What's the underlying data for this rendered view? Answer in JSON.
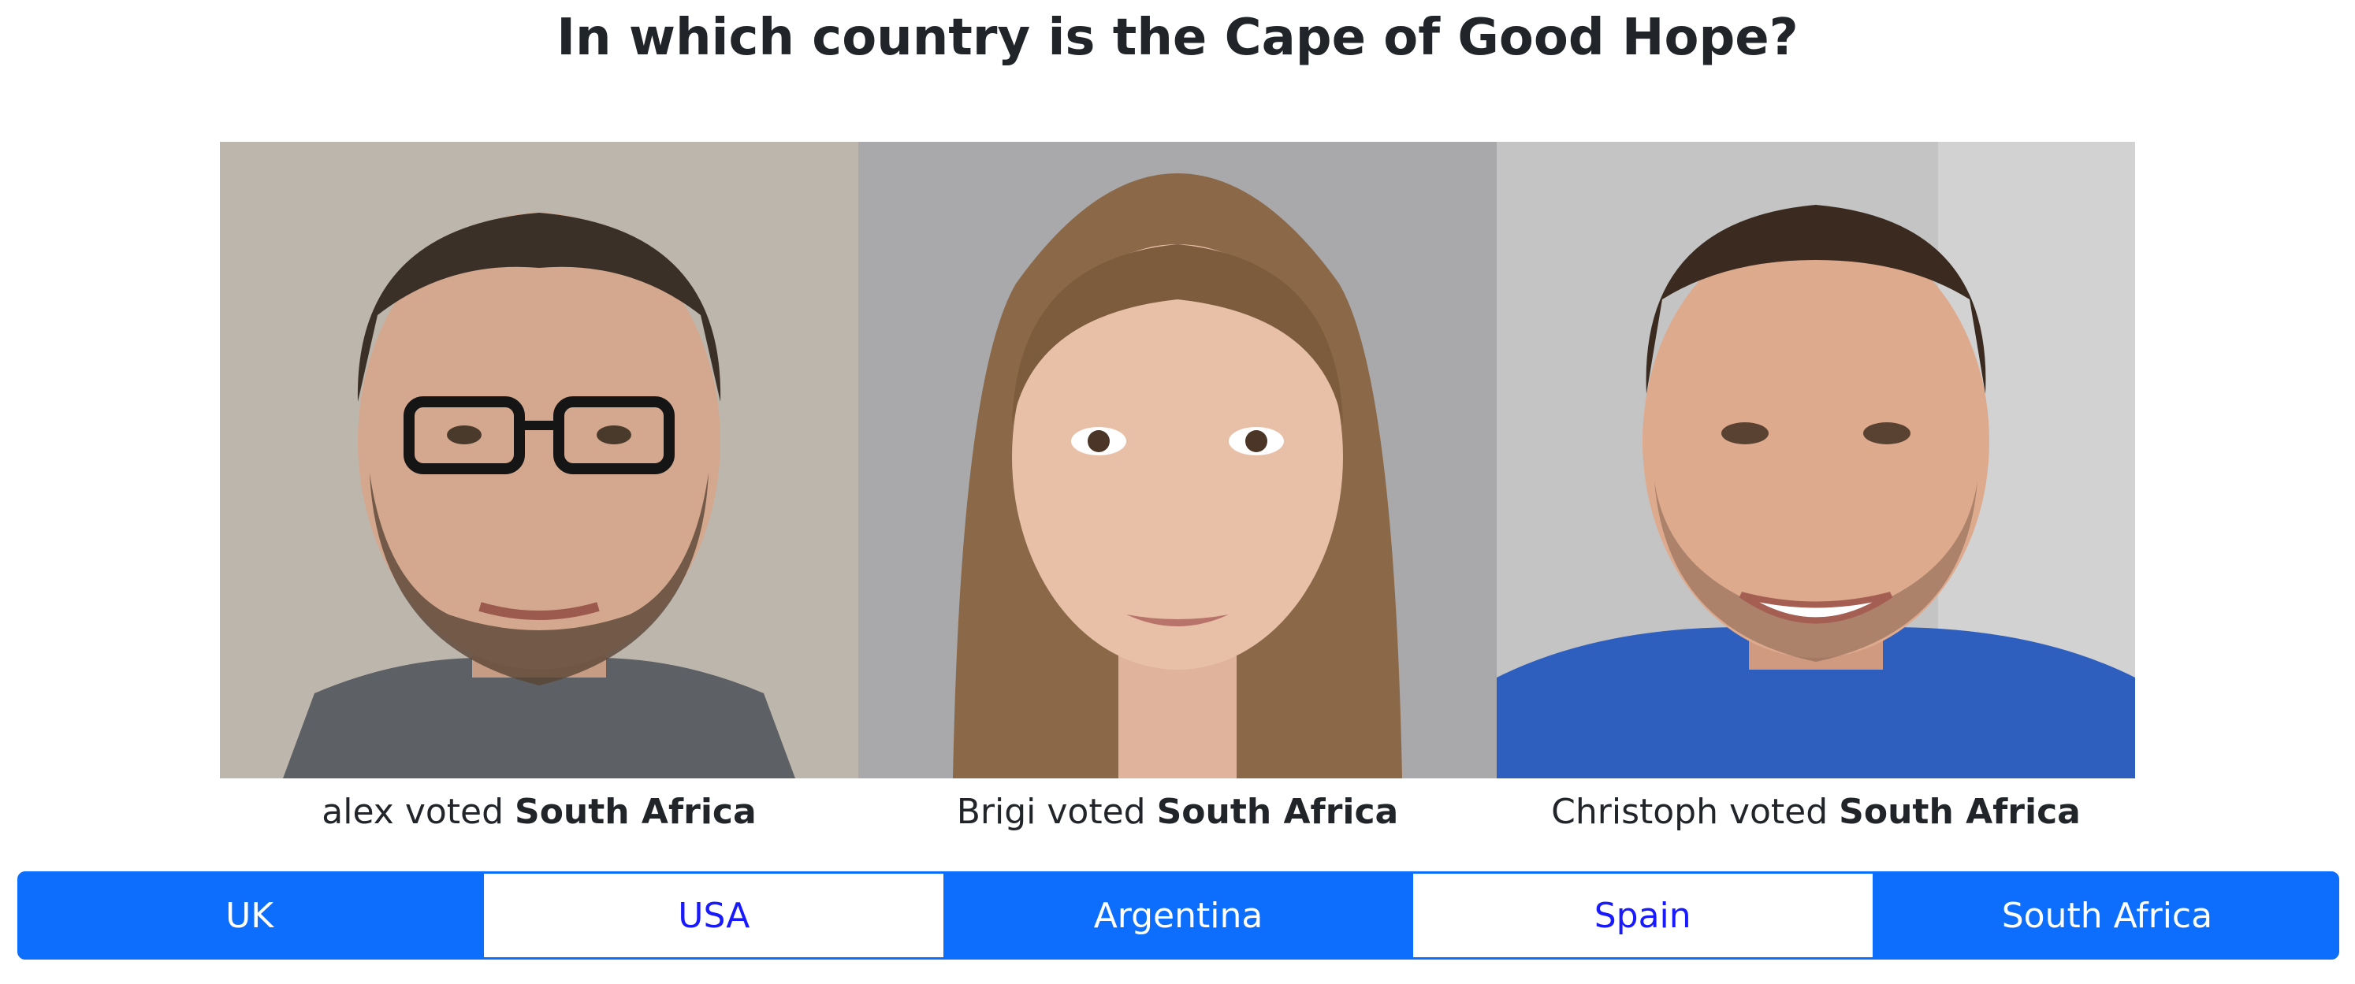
{
  "question": "In which country is the Cape of Good Hope?",
  "voters": [
    {
      "name": "alex",
      "verb": " voted ",
      "choice": "South Africa"
    },
    {
      "name": "Brigi",
      "verb": " voted ",
      "choice": "South Africa"
    },
    {
      "name": "Christoph",
      "verb": " voted ",
      "choice": "South Africa"
    }
  ],
  "answers": [
    {
      "label": "UK",
      "style": "filled"
    },
    {
      "label": "USA",
      "style": "outline"
    },
    {
      "label": "Argentina",
      "style": "filled"
    },
    {
      "label": "Spain",
      "style": "outline"
    },
    {
      "label": "South Africa",
      "style": "filled"
    }
  ],
  "colors": {
    "accent": "#0d6efd",
    "outline_text": "#1a1aff",
    "text": "#212529"
  }
}
